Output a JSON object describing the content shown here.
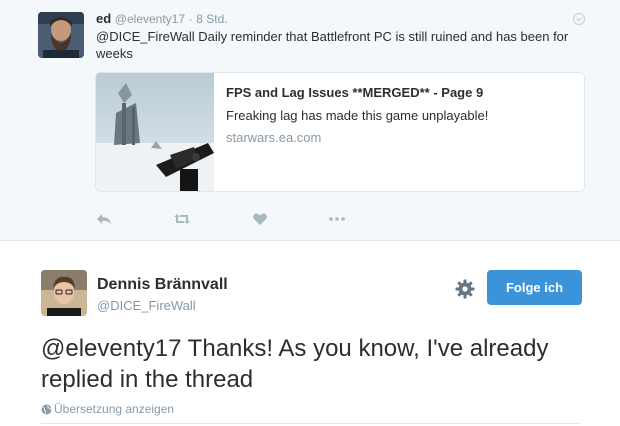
{
  "tweet1": {
    "name": "ed",
    "handle": "@eleventy17",
    "separator": "·",
    "time": "8 Std.",
    "text": "@DICE_FireWall Daily reminder that Battlefront PC is still ruined and has been for weeks",
    "card": {
      "title": "FPS and Lag Issues **MERGED** - Page 9",
      "description": "Freaking lag has made this game unplayable!",
      "domain": "starwars.ea.com"
    },
    "actions": [
      "reply-icon",
      "retweet-icon",
      "like-icon",
      "more-icon"
    ]
  },
  "tweet2": {
    "name": "Dennis Brännvall",
    "handle": "@DICE_FireWall",
    "follow_label": "Folge ich",
    "text": "@eleventy17 Thanks! As you know, I've already replied in the thread",
    "translate_label": "Übersetzung anzeigen"
  },
  "colors": {
    "accent": "#3b94d9",
    "muted": "#8899a6",
    "text": "#292f33",
    "bg_top": "#f5f8fa",
    "border": "#e1e8ed"
  }
}
